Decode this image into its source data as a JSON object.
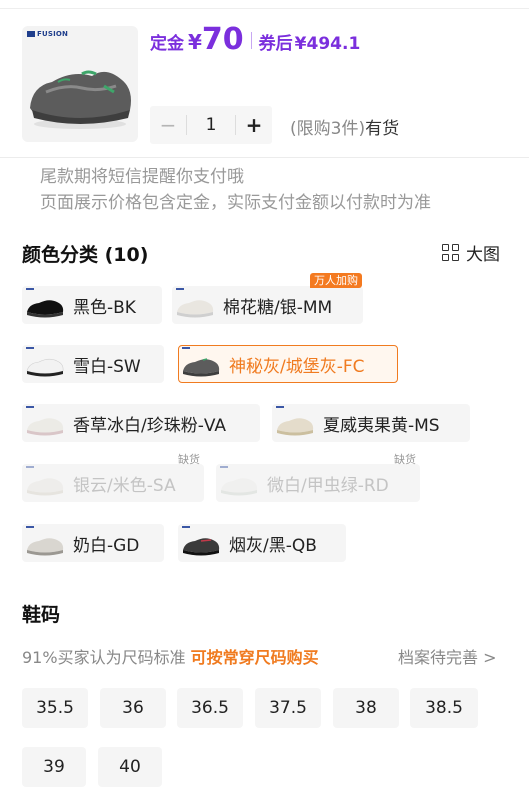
{
  "product": {
    "brand": "FUSION",
    "deposit_label": "定金",
    "currency": "¥",
    "deposit_amount": "70",
    "coupon_label": "券后",
    "coupon_price": "¥494.1",
    "quantity": "1",
    "minus": "−",
    "plus": "+",
    "limit_text": "(限购3件)",
    "stock_text": "有货"
  },
  "notice": {
    "line1": "尾款期将短信提醒你支付哦",
    "line2": "页面展示价格包含定金，实际支付金额以付款时为准"
  },
  "color_section": {
    "title": "颜色分类 (10)",
    "big_image_label": "大图",
    "hot_badge": "万人加购",
    "soldout_badge": "缺货",
    "options": [
      {
        "label": "黑色-BK",
        "state": "normal"
      },
      {
        "label": "棉花糖/银-MM",
        "state": "hot"
      },
      {
        "label": "雪白-SW",
        "state": "normal"
      },
      {
        "label": "神秘灰/城堡灰-FC",
        "state": "selected"
      },
      {
        "label": "香草冰白/珍珠粉-VA",
        "state": "normal"
      },
      {
        "label": "夏威夷果黄-MS",
        "state": "normal"
      },
      {
        "label": "银云/米色-SA",
        "state": "soldout"
      },
      {
        "label": "微白/甲虫绿-RD",
        "state": "soldout"
      },
      {
        "label": "奶白-GD",
        "state": "normal"
      },
      {
        "label": "烟灰/黑-QB",
        "state": "normal"
      }
    ]
  },
  "size_section": {
    "title": "鞋码",
    "fit_text": "91%买家认为尺码标准",
    "fit_tip": "可按常穿尺码购买",
    "archive_text": "档案待完善 >",
    "sizes": [
      "35.5",
      "36",
      "36.5",
      "37.5",
      "38",
      "38.5",
      "39",
      "40"
    ]
  },
  "colors": {
    "price_purple": "#7b2fdd",
    "accent_orange": "#f07b20",
    "chip_bg": "#f5f5f5"
  }
}
